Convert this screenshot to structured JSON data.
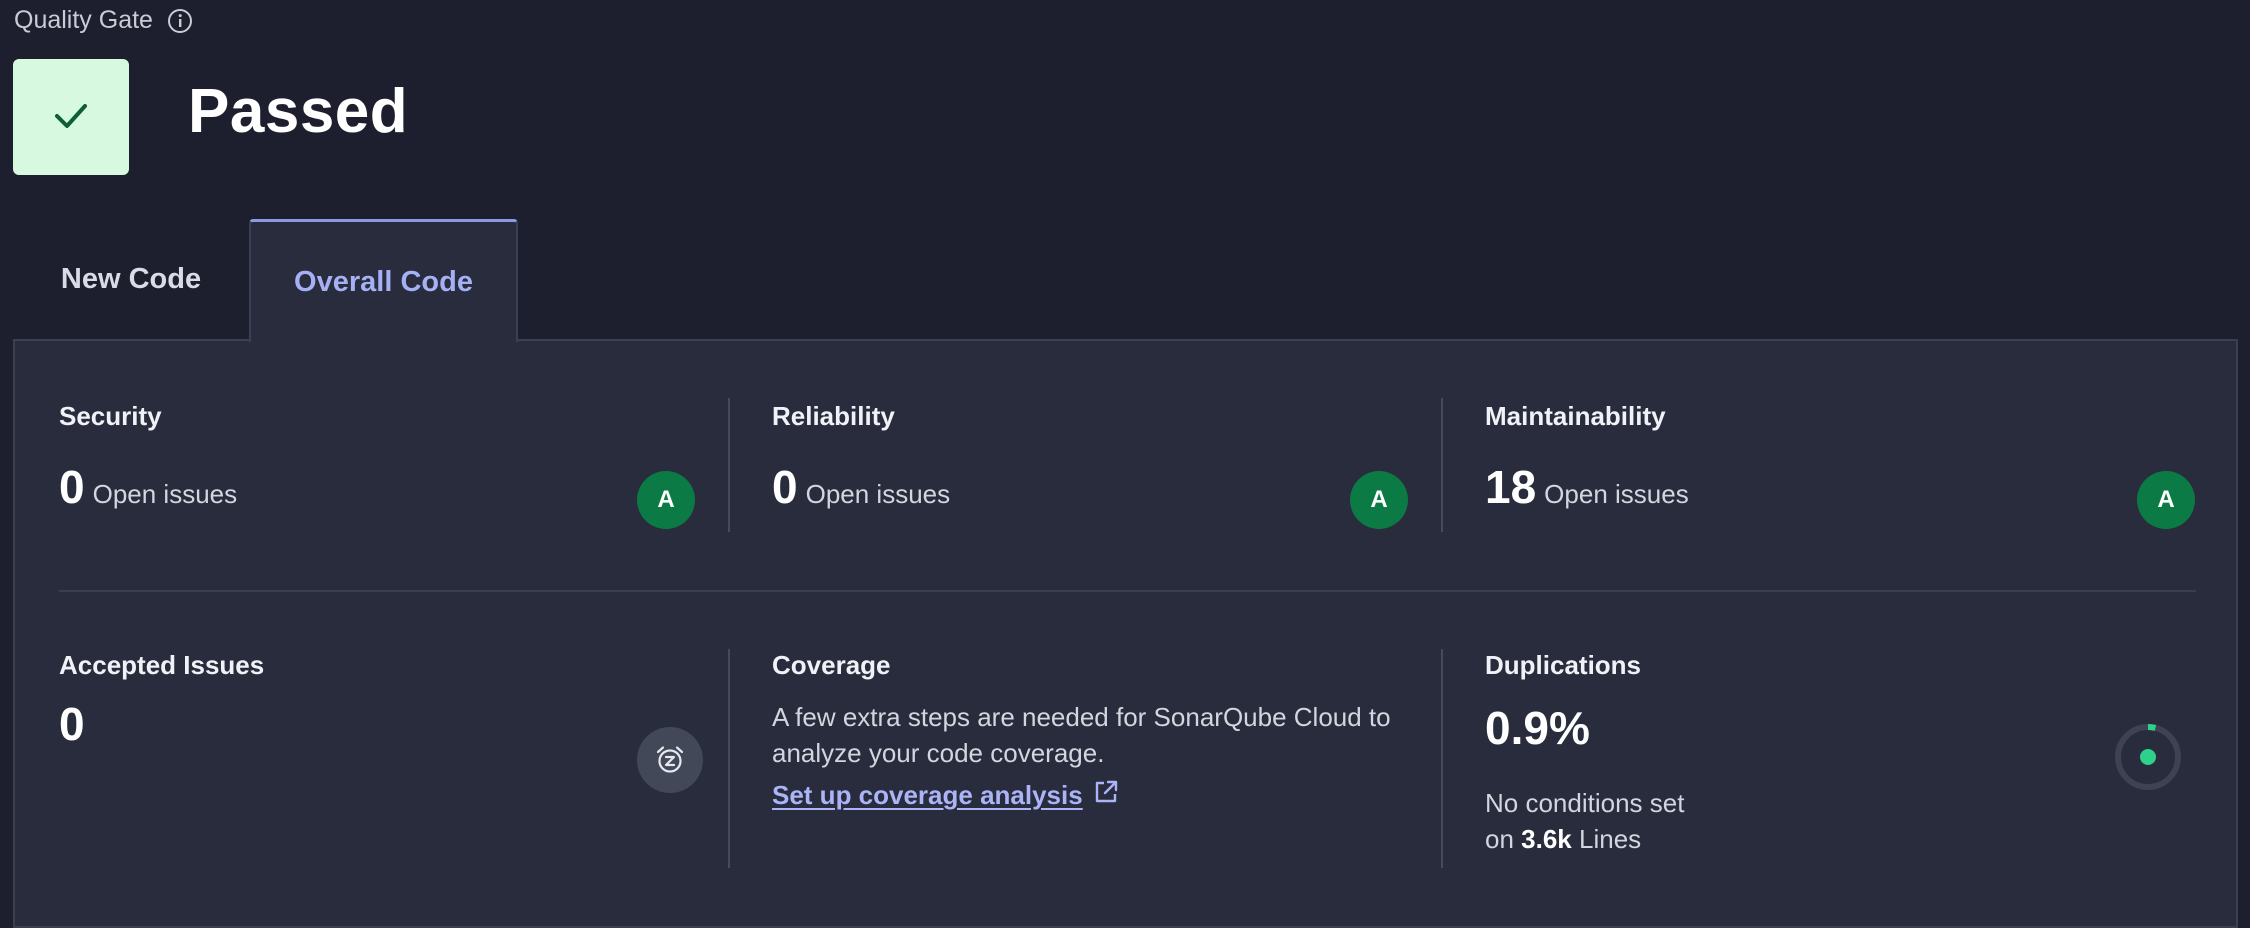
{
  "quality_gate": {
    "label": "Quality Gate",
    "status": "Passed",
    "status_color": "#d6f9e0",
    "icons": {
      "info": "info-icon",
      "status": "check-icon"
    }
  },
  "tabs": [
    {
      "label": "New Code",
      "selected": false
    },
    {
      "label": "Overall Code",
      "selected": true
    }
  ],
  "ratings": [
    {
      "title": "Security",
      "value": "0",
      "unit": "Open issues",
      "grade": "A"
    },
    {
      "title": "Reliability",
      "value": "0",
      "unit": "Open issues",
      "grade": "A"
    },
    {
      "title": "Maintainability",
      "value": "18",
      "unit": "Open issues",
      "grade": "A"
    }
  ],
  "accepted_issues": {
    "title": "Accepted Issues",
    "value": "0",
    "icon": "snooze-icon"
  },
  "coverage": {
    "title": "Coverage",
    "description": "A few extra steps are needed for SonarQube Cloud to analyze your code coverage.",
    "link_label": "Set up coverage analysis",
    "link_icon": "external-link-icon"
  },
  "duplications": {
    "title": "Duplications",
    "value": "0.9%",
    "note_prefix": "No conditions set",
    "note_on": "on",
    "lines_count": "3.6k",
    "lines_label": "Lines",
    "ratio": 0.009
  },
  "colors": {
    "grade_a": "#0c7a45",
    "accent": "#a6b0f4",
    "donut_fill": "#2fd08a"
  }
}
